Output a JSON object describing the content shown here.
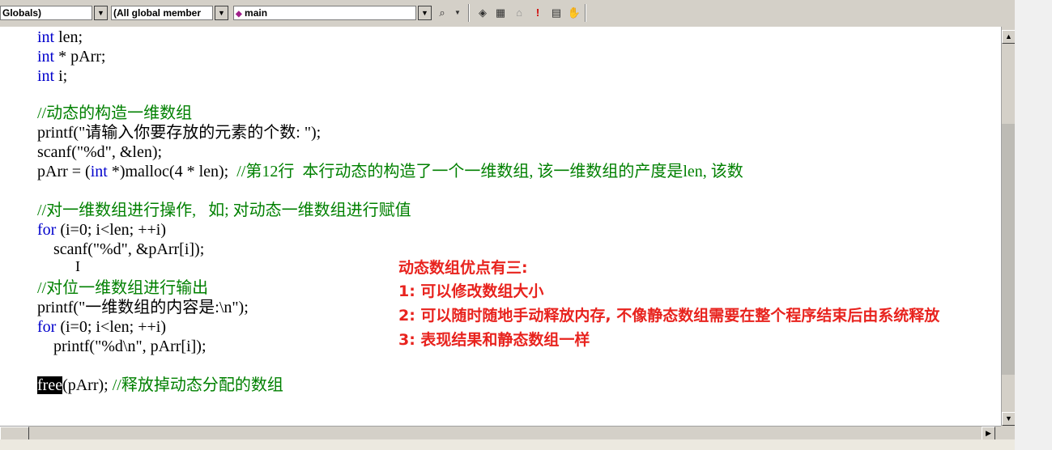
{
  "toolbar": {
    "scope_combo": "Globals)",
    "member_combo": "(All global member",
    "function_combo": "main",
    "function_icon": "diamond-icon",
    "button_icons": [
      "wizard-bar-icon",
      "class-wizard-icon",
      "compile-icon",
      "build-icon",
      "stop-build-icon",
      "execute-icon",
      "output-icon",
      "hand-icon"
    ]
  },
  "code": {
    "l1_type": "int",
    "l1_rest": " len;",
    "l2_type": "int",
    "l2_rest": " * pArr;",
    "l3_type": "int",
    "l3_rest": " i;",
    "l4_comment": "//动态的构造一维数组",
    "l5": "printf(\"请输入你要存放的元素的个数: \");",
    "l6": "scanf(\"%d\", &len);",
    "l7_a": "pArr = (",
    "l7_type": "int",
    "l7_b": " *)malloc(4 * len);  ",
    "l7_comment": "//第12行  本行动态的构造了一个一维数组, 该一维数组的产度是len, 该数",
    "l8_comment": "//对一维数组进行操作,   如; 对动态一维数组进行赋值",
    "l9_kw": "for",
    "l9_rest": " (i=0; i<len; ++i)",
    "l10": "    scanf(\"%d\", &pArr[i]);",
    "l11_comment": "//对位一维数组进行输出",
    "l12": "printf(\"一维数组的内容是:\\n\");",
    "l13_kw": "for",
    "l13_rest": " (i=0; i<len; ++i)",
    "l14": "    printf(\"%d\\n\", pArr[i]);",
    "l15_sel": "free",
    "l15_rest": "(pArr); ",
    "l15_comment": "//释放掉动态分配的数组",
    "cursor": "I"
  },
  "notes": {
    "title": "动态数组优点有三:",
    "item1": "1: 可以修改数组大小",
    "item2": "2: 可以随时随地手动释放内存, 不像静态数组需要在整个程序结束后由系统释放",
    "item3": "3: 表现结果和静态数组一样"
  },
  "colors": {
    "keyword": "#0000cc",
    "comment": "#008000",
    "note": "#e8231e",
    "toolbar_bg": "#d4d0c8"
  }
}
